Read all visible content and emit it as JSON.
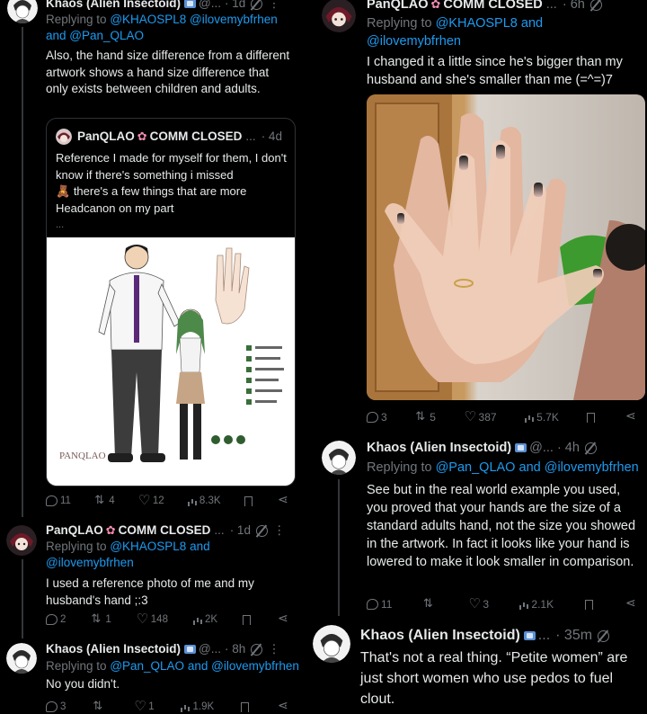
{
  "left": {
    "t1": {
      "name": "Khaos (Alien Insectoid)",
      "handle": "@...",
      "time": "· 1d",
      "reply_prefix": "Replying to",
      "reply_links": "@KHAOSPL8 @ilovemybfrhen",
      "reply_and": "and",
      "reply_links2": "@Pan_QLAO",
      "body": "Also, the hand size difference from a different artwork shows a hand size difference that only exists between children and adults.",
      "quote": {
        "name": "PanQLAO",
        "status": "COMM CLOSED",
        "dots": "...",
        "time": "· 4d",
        "body1": "Reference I made for myself for them, I don't know if there's something i missed",
        "body2": "there's a few things that are more Headcanon on my part",
        "ellipsis": "...",
        "image_text": "PANQLAO"
      },
      "stats": {
        "replies": "11",
        "reposts": "4",
        "likes": "12",
        "views": "8.3K"
      }
    },
    "t2": {
      "name": "PanQLAO",
      "status": "COMM CLOSED",
      "dots": "...",
      "time": "· 1d",
      "reply_prefix": "Replying to",
      "reply_links": "@KHAOSPL8",
      "reply_and": "and",
      "reply_links2": "@ilovemybfrhen",
      "body": "I used a reference photo of me and my husband's hand ;:3",
      "stats": {
        "replies": "2",
        "reposts": "1",
        "likes": "148",
        "views": "2K"
      }
    },
    "t3": {
      "name": "Khaos (Alien Insectoid)",
      "handle": "@...",
      "time": "· 8h",
      "reply_prefix": "Replying to",
      "reply_links": "@Pan_QLAO",
      "reply_and": "and",
      "reply_links2": "@ilovemybfrhen",
      "body": "No you didn't.",
      "stats": {
        "replies": "3",
        "reposts": "",
        "likes": "1",
        "views": "1.9K"
      }
    }
  },
  "right": {
    "t1": {
      "name": "PanQLAO",
      "status": "COMM CLOSED",
      "dots": "...",
      "time": "· 6h",
      "reply_prefix": "Replying to",
      "reply_links": "@KHAOSPL8",
      "reply_and": "and",
      "reply_links2": "@ilovemybfrhen",
      "body": "I changed it a little since he's bigger than my husband and she's smaller than me (=^=)7",
      "stats": {
        "replies": "3",
        "reposts": "5",
        "likes": "387",
        "views": "5.7K"
      }
    },
    "t2": {
      "name": "Khaos (Alien Insectoid)",
      "handle": "@...",
      "time": "· 4h",
      "reply_prefix": "Replying to",
      "reply_links": "@Pan_QLAO",
      "reply_and": "and",
      "reply_links2": "@ilovemybfrhen",
      "body": "See but in the real world example you used, you proved that your hands are the size of a standard adults hand, not the size you showed in the artwork. In fact it looks like your hand is lowered to make it look smaller in comparison.",
      "stats": {
        "replies": "11",
        "reposts": "",
        "likes": "3",
        "views": "2.1K"
      }
    },
    "t3": {
      "name": "Khaos (Alien Insectoid)",
      "handle": "...",
      "time": "· 35m",
      "body": "That's not a real thing. “Petite women” are just short women who use pedos to fuel clout."
    }
  },
  "colors": {
    "link": "#1d9bf0",
    "muted": "#71767b",
    "text": "#e7e9ea",
    "bg": "#000000",
    "border": "#2f3336"
  }
}
